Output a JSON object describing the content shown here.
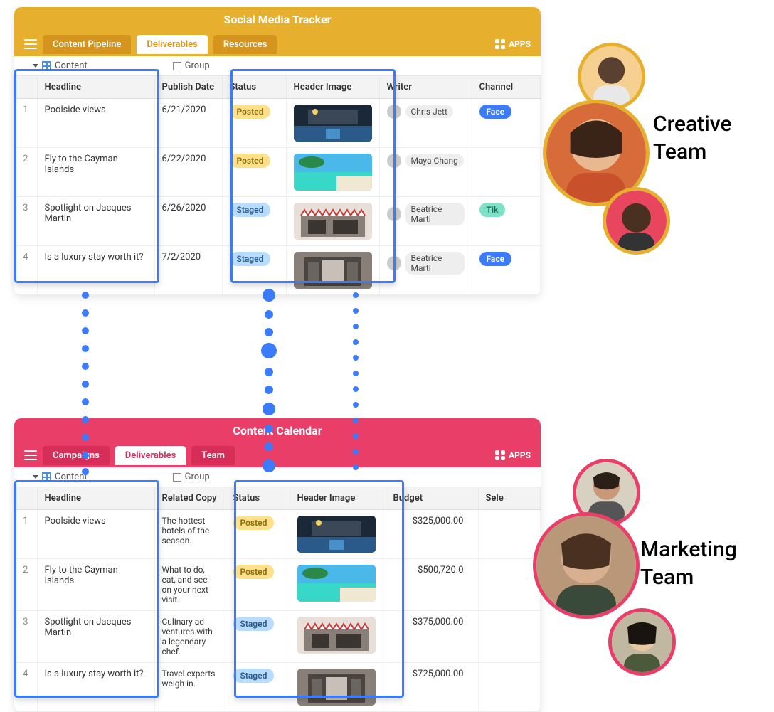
{
  "panel1": {
    "title": "Social Media Tracker",
    "tabs": [
      "Content Pipeline",
      "Deliverables",
      "Resources"
    ],
    "active_tab": 1,
    "apps": "APPS",
    "view": {
      "content": "Content",
      "group": "Group"
    },
    "cols": [
      "",
      "Headline",
      "Publish Date",
      "Status",
      "Header Image",
      "Writer",
      "Channel"
    ],
    "rows": [
      {
        "n": "1",
        "headline": "Poolside views",
        "date": "6/21/2020",
        "status": "Posted",
        "writer": "Chris Jett",
        "channel": "Face"
      },
      {
        "n": "2",
        "headline": "Fly to the Cayman Islands",
        "date": "6/22/2020",
        "status": "Posted",
        "writer": "Maya Chang",
        "channel": ""
      },
      {
        "n": "3",
        "headline": "Spotlight on Jacques Martin",
        "date": "6/26/2020",
        "status": "Staged",
        "writer": "Beatrice Marti",
        "channel": "Tik"
      },
      {
        "n": "4",
        "headline": "Is a luxury stay worth it?",
        "date": "7/2/2020",
        "status": "Staged",
        "writer": "Beatrice Marti",
        "channel": "Face"
      }
    ]
  },
  "panel2": {
    "title": "Content Calendar",
    "tabs": [
      "Campaigns",
      "Deliverables",
      "Team"
    ],
    "active_tab": 1,
    "apps": "APPS",
    "view": {
      "content": "Content",
      "group": "Group"
    },
    "cols": [
      "",
      "Headline",
      "Related Copy",
      "Status",
      "Header Image",
      "Budget",
      "Sele"
    ],
    "rows": [
      {
        "n": "1",
        "headline": "Poolside views",
        "copy": "The hottest hotels of the season.",
        "status": "Posted",
        "budget": "$325,000.00"
      },
      {
        "n": "2",
        "headline": "Fly to the Cayman Islands",
        "copy": "What to do, eat, and see on your next visit.",
        "status": "Posted",
        "budget": "$500,720.0"
      },
      {
        "n": "3",
        "headline": "Spotlight on Jacques Martin",
        "copy": "Culinary ad-ventures with a legendary chef.",
        "status": "Staged",
        "budget": "$375,000.00"
      },
      {
        "n": "4",
        "headline": "Is a luxury stay worth it?",
        "copy": "Travel experts weigh in.",
        "status": "Staged",
        "budget": "$725,000.00"
      }
    ]
  },
  "teams": {
    "creative": "Creative\nTeam",
    "marketing": "Marketing\nTeam"
  },
  "colors": {
    "gold": "#e6b02e",
    "pink": "#e83e68",
    "blue": "#3b7cff"
  }
}
